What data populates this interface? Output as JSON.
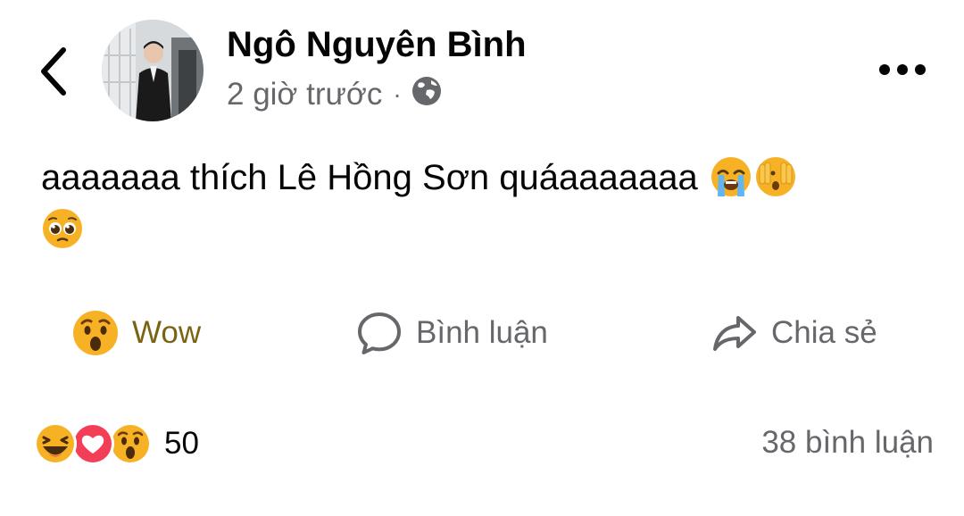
{
  "post": {
    "author": "Ngô Nguyên Bình",
    "time": "2 giờ trước",
    "separator": "·",
    "audience_icon": "globe-icon",
    "text": "aaaaaaa thích Lê Hồng Sơn quáaaaaaaa",
    "inline_emojis": [
      "loudly-crying-face",
      "face-with-open-eyes-and-hand-over-mouth",
      "pleading-face"
    ]
  },
  "actions": {
    "reaction_label": "Wow",
    "comment_label": "Bình luận",
    "share_label": "Chia sẻ"
  },
  "summary": {
    "reactions": [
      "haha-icon",
      "love-icon",
      "wow-icon"
    ],
    "reaction_count": "50",
    "comment_count": "38 bình luận"
  },
  "colors": {
    "primary_text": "#050505",
    "secondary_text": "#65676b",
    "wow_active": "#7a6413",
    "love_red": "#f33e58",
    "emoji_yellow": "#f7b125"
  }
}
